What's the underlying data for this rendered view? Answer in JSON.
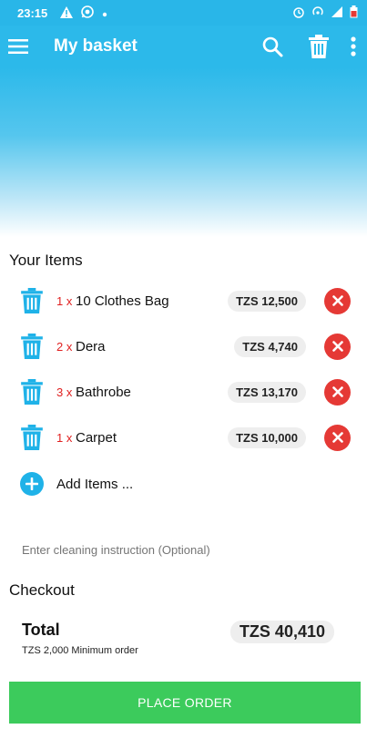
{
  "status_bar": {
    "time": "23:15",
    "left_icons": [
      "warning-icon",
      "whatsapp-icon",
      "dot-icon"
    ],
    "right_icons": [
      "alarm-icon",
      "hotspot-icon",
      "signal-icon",
      "battery-icon"
    ]
  },
  "app_bar": {
    "title": "My basket",
    "actions": [
      "search-icon",
      "trash-icon",
      "more-vert-icon"
    ]
  },
  "items_section": {
    "title": "Your Items",
    "items": [
      {
        "qty": "1 x",
        "name": "10 Clothes Bag",
        "price": "TZS 12,500"
      },
      {
        "qty": "2 x",
        "name": "Dera",
        "price": "TZS 4,740"
      },
      {
        "qty": "3 x",
        "name": "Bathrobe",
        "price": "TZS 13,170"
      },
      {
        "qty": "1 x",
        "name": "Carpet",
        "price": "TZS 10,000"
      }
    ],
    "add_label": "Add Items ..."
  },
  "instruction": {
    "placeholder": "Enter cleaning instruction (Optional)"
  },
  "checkout": {
    "title": "Checkout",
    "total_label": "Total",
    "total_value": "TZS 40,410",
    "min_order": "TZS 2,000 Minimum order"
  },
  "place_order_label": "PLACE ORDER",
  "colors": {
    "primary": "#2cb9ea",
    "remove": "#e53935",
    "qty": "#e02020",
    "place_order": "#3ccb5c"
  }
}
